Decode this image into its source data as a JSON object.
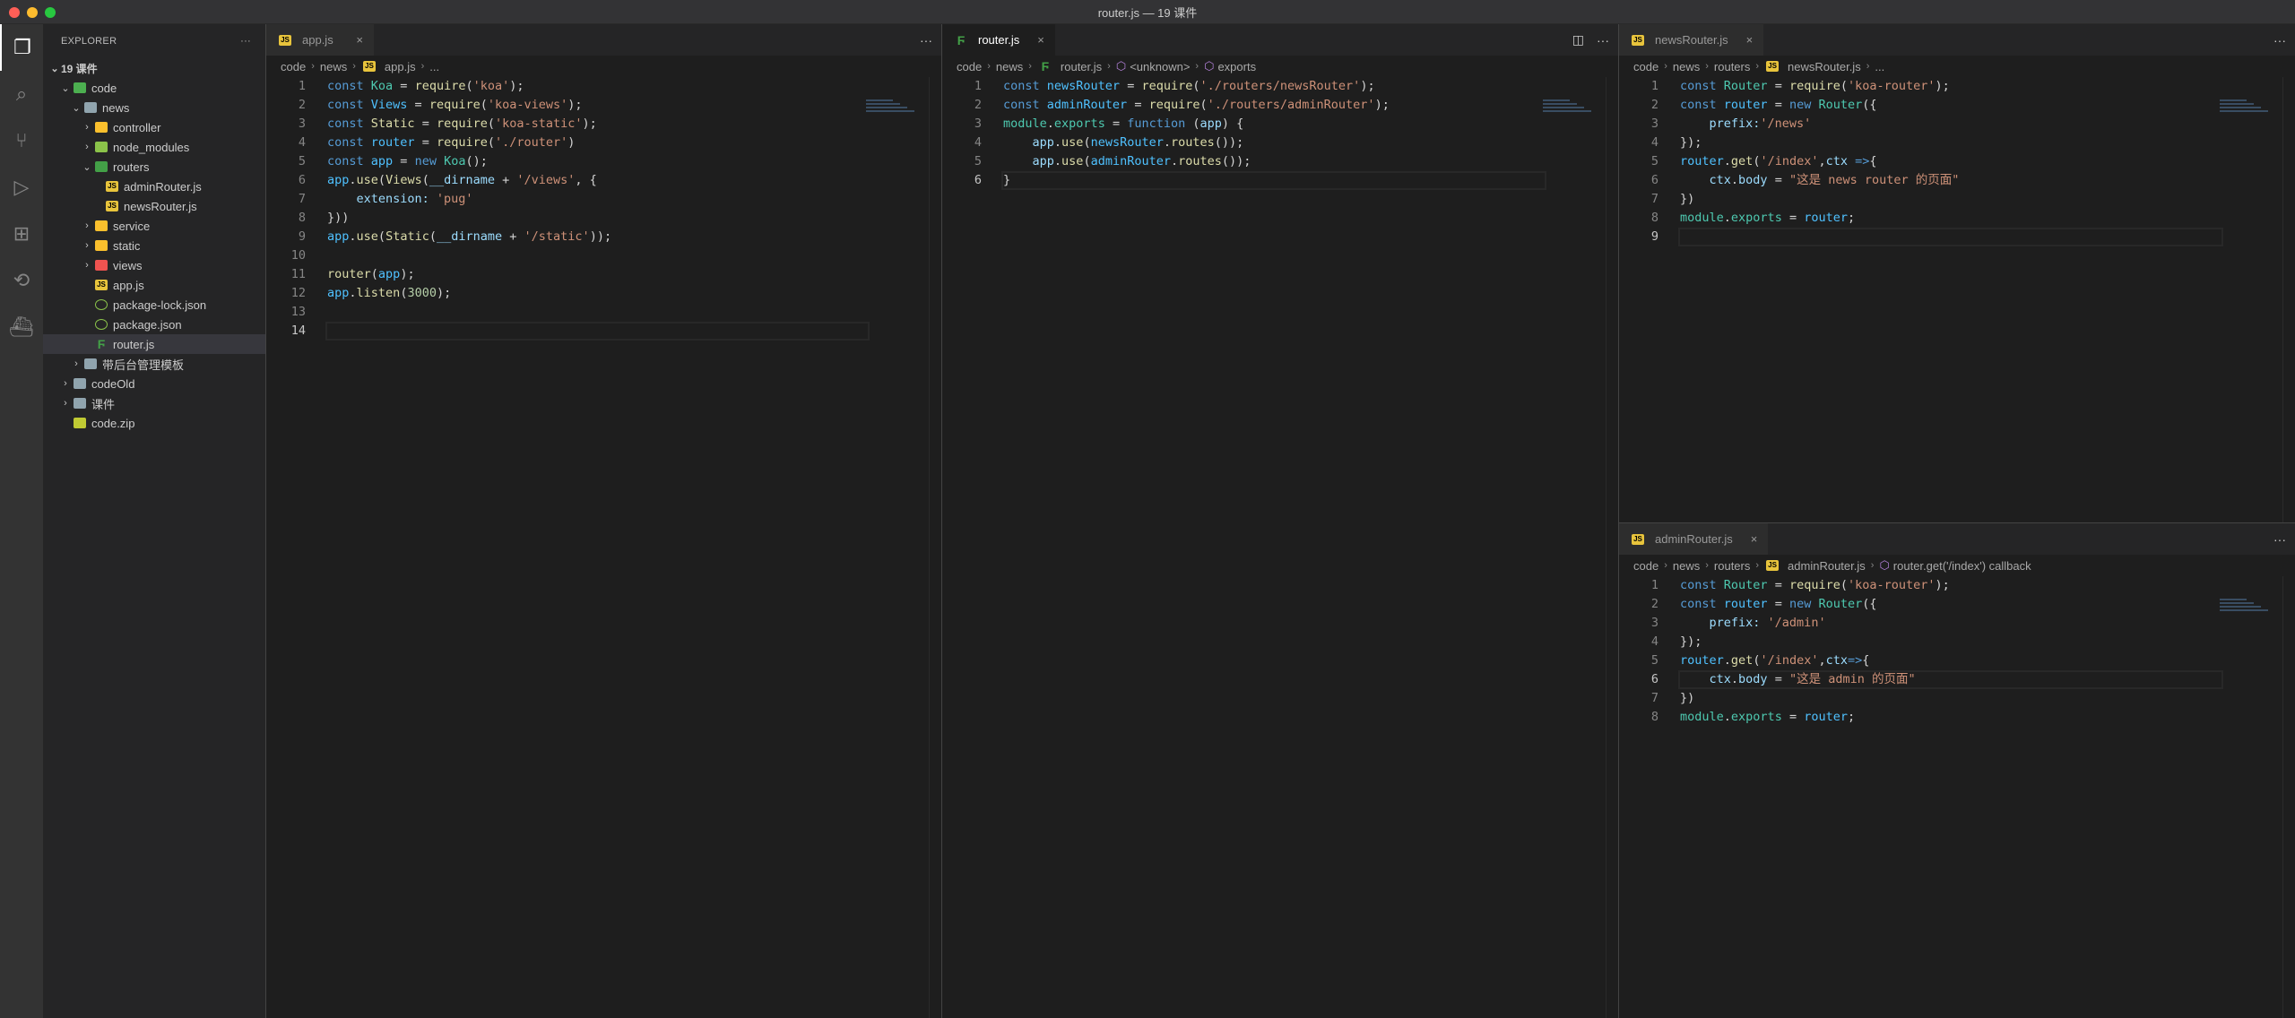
{
  "window": {
    "title": "router.js — 19 课件"
  },
  "activity_bar": [
    "files-icon",
    "search-icon",
    "source-control-icon",
    "run-debug-icon",
    "extensions-icon",
    "remote-icon",
    "docker-icon"
  ],
  "sidebar": {
    "title": "EXPLORER",
    "more": "···",
    "root": "19 课件",
    "items": [
      {
        "label": "code",
        "depth": 1,
        "chevron": "v",
        "icon": "folder-src",
        "color": "#4caf50"
      },
      {
        "label": "news",
        "depth": 2,
        "chevron": "v",
        "icon": "folder",
        "color": "#90a4ae"
      },
      {
        "label": "controller",
        "depth": 3,
        "chevron": ">",
        "icon": "folder-controller",
        "color": "#fbc02d"
      },
      {
        "label": "node_modules",
        "depth": 3,
        "chevron": ">",
        "icon": "folder-node",
        "color": "#8bc34a"
      },
      {
        "label": "routers",
        "depth": 3,
        "chevron": "v",
        "icon": "folder-routes",
        "color": "#43a047"
      },
      {
        "label": "adminRouter.js",
        "depth": 4,
        "chevron": "",
        "icon": "js",
        "color": "#e8c43c"
      },
      {
        "label": "newsRouter.js",
        "depth": 4,
        "chevron": "",
        "icon": "js",
        "color": "#e8c43c"
      },
      {
        "label": "service",
        "depth": 3,
        "chevron": ">",
        "icon": "folder-service",
        "color": "#fbc02d"
      },
      {
        "label": "static",
        "depth": 3,
        "chevron": ">",
        "icon": "folder-static",
        "color": "#fbc02d"
      },
      {
        "label": "views",
        "depth": 3,
        "chevron": ">",
        "icon": "folder-views",
        "color": "#ef5350"
      },
      {
        "label": "app.js",
        "depth": 3,
        "chevron": "",
        "icon": "js",
        "color": "#e8c43c"
      },
      {
        "label": "package-lock.json",
        "depth": 3,
        "chevron": "",
        "icon": "nodejs",
        "color": "#8bc34a"
      },
      {
        "label": "package.json",
        "depth": 3,
        "chevron": "",
        "icon": "nodejs",
        "color": "#8bc34a"
      },
      {
        "label": "router.js",
        "depth": 3,
        "chevron": "",
        "icon": "routing",
        "color": "#43a047",
        "selected": true
      },
      {
        "label": "带后台管理模板",
        "depth": 2,
        "chevron": ">",
        "icon": "folder",
        "color": "#90a4ae"
      },
      {
        "label": "codeOld",
        "depth": 1,
        "chevron": ">",
        "icon": "folder",
        "color": "#90a4ae"
      },
      {
        "label": "课件",
        "depth": 1,
        "chevron": ">",
        "icon": "folder",
        "color": "#90a4ae"
      },
      {
        "label": "code.zip",
        "depth": 1,
        "chevron": "",
        "icon": "zip",
        "color": "#c0ca33"
      }
    ]
  },
  "editors": [
    {
      "tab": "app.js",
      "active": false,
      "icon": "js",
      "crumbs": [
        "code",
        "news",
        "app.js",
        "..."
      ],
      "current_line": 14,
      "lines": [
        [
          [
            "const ",
            "k"
          ],
          [
            "Koa",
            "c"
          ],
          [
            " = ",
            "p"
          ],
          [
            "require",
            "f"
          ],
          [
            "(",
            "p"
          ],
          [
            "'koa'",
            "s"
          ],
          [
            ");",
            "p"
          ]
        ],
        [
          [
            "const ",
            "k"
          ],
          [
            "Views",
            "b"
          ],
          [
            " = ",
            "p"
          ],
          [
            "require",
            "f"
          ],
          [
            "(",
            "p"
          ],
          [
            "'koa-views'",
            "s"
          ],
          [
            ");",
            "p"
          ]
        ],
        [
          [
            "const ",
            "k"
          ],
          [
            "Static",
            "f"
          ],
          [
            " = ",
            "p"
          ],
          [
            "require",
            "f"
          ],
          [
            "(",
            "p"
          ],
          [
            "'koa-static'",
            "s"
          ],
          [
            ");",
            "p"
          ]
        ],
        [
          [
            "const ",
            "k"
          ],
          [
            "router",
            "b"
          ],
          [
            " = ",
            "p"
          ],
          [
            "require",
            "f"
          ],
          [
            "(",
            "p"
          ],
          [
            "'./router'",
            "s"
          ],
          [
            ")",
            "p"
          ]
        ],
        [
          [
            "const ",
            "k"
          ],
          [
            "app",
            "b"
          ],
          [
            " = ",
            "p"
          ],
          [
            "new ",
            "k"
          ],
          [
            "Koa",
            "c"
          ],
          [
            "();",
            "p"
          ]
        ],
        [
          [
            "app",
            "b"
          ],
          [
            ".",
            "p"
          ],
          [
            "use",
            "f"
          ],
          [
            "(",
            "p"
          ],
          [
            "Views",
            "f"
          ],
          [
            "(",
            "p"
          ],
          [
            "__dirname",
            "v"
          ],
          [
            " + ",
            "p"
          ],
          [
            "'/views'",
            "s"
          ],
          [
            ", {",
            "p"
          ]
        ],
        [
          [
            "    extension: ",
            "v"
          ],
          [
            "'pug'",
            "s"
          ]
        ],
        [
          [
            "}))",
            "p"
          ]
        ],
        [
          [
            "app",
            "b"
          ],
          [
            ".",
            "p"
          ],
          [
            "use",
            "f"
          ],
          [
            "(",
            "p"
          ],
          [
            "Static",
            "f"
          ],
          [
            "(",
            "p"
          ],
          [
            "__dirname",
            "v"
          ],
          [
            " + ",
            "p"
          ],
          [
            "'/static'",
            "s"
          ],
          [
            "));",
            "p"
          ]
        ],
        [],
        [
          [
            "router",
            "f"
          ],
          [
            "(",
            "p"
          ],
          [
            "app",
            "b"
          ],
          [
            ");",
            "p"
          ]
        ],
        [
          [
            "app",
            "b"
          ],
          [
            ".",
            "p"
          ],
          [
            "listen",
            "f"
          ],
          [
            "(",
            "p"
          ],
          [
            "3000",
            "n"
          ],
          [
            ");",
            "p"
          ]
        ],
        [],
        []
      ]
    },
    {
      "tab": "router.js",
      "active": true,
      "icon": "routing",
      "crumbs": [
        "code",
        "news",
        "router.js",
        "<unknown>",
        "exports"
      ],
      "current_line": 6,
      "lines": [
        [
          [
            "const ",
            "k"
          ],
          [
            "newsRouter",
            "b"
          ],
          [
            " = ",
            "p"
          ],
          [
            "require",
            "f"
          ],
          [
            "(",
            "p"
          ],
          [
            "'./routers/newsRouter'",
            "s"
          ],
          [
            ");",
            "p"
          ]
        ],
        [
          [
            "const ",
            "k"
          ],
          [
            "adminRouter",
            "b"
          ],
          [
            " = ",
            "p"
          ],
          [
            "require",
            "f"
          ],
          [
            "(",
            "p"
          ],
          [
            "'./routers/adminRouter'",
            "s"
          ],
          [
            ");",
            "p"
          ]
        ],
        [
          [
            "module",
            "c"
          ],
          [
            ".",
            "p"
          ],
          [
            "exports",
            "c"
          ],
          [
            " = ",
            "p"
          ],
          [
            "function ",
            "k"
          ],
          [
            "(",
            "p"
          ],
          [
            "app",
            "v"
          ],
          [
            ") {",
            "p"
          ]
        ],
        [
          [
            "    app",
            "v"
          ],
          [
            ".",
            "p"
          ],
          [
            "use",
            "f"
          ],
          [
            "(",
            "p"
          ],
          [
            "newsRouter",
            "b"
          ],
          [
            ".",
            "p"
          ],
          [
            "routes",
            "f"
          ],
          [
            "());",
            "p"
          ]
        ],
        [
          [
            "    app",
            "v"
          ],
          [
            ".",
            "p"
          ],
          [
            "use",
            "f"
          ],
          [
            "(",
            "p"
          ],
          [
            "adminRouter",
            "b"
          ],
          [
            ".",
            "p"
          ],
          [
            "routes",
            "f"
          ],
          [
            "());",
            "p"
          ]
        ],
        [
          [
            "}",
            "p"
          ]
        ]
      ]
    },
    {
      "tab": "newsRouter.js",
      "active": false,
      "icon": "js",
      "crumbs": [
        "code",
        "news",
        "routers",
        "newsRouter.js",
        "..."
      ],
      "current_line": 9,
      "lines": [
        [
          [
            "const ",
            "k"
          ],
          [
            "Router",
            "c"
          ],
          [
            " = ",
            "p"
          ],
          [
            "require",
            "f"
          ],
          [
            "(",
            "p"
          ],
          [
            "'koa-router'",
            "s"
          ],
          [
            ");",
            "p"
          ]
        ],
        [
          [
            "const ",
            "k"
          ],
          [
            "router",
            "b"
          ],
          [
            " = ",
            "p"
          ],
          [
            "new ",
            "k"
          ],
          [
            "Router",
            "c"
          ],
          [
            "({",
            "p"
          ]
        ],
        [
          [
            "    prefix:",
            "v"
          ],
          [
            "'/news'",
            "s"
          ]
        ],
        [
          [
            "});",
            "p"
          ]
        ],
        [
          [
            "router",
            "b"
          ],
          [
            ".",
            "p"
          ],
          [
            "get",
            "f"
          ],
          [
            "(",
            "p"
          ],
          [
            "'/index'",
            "s"
          ],
          [
            ",",
            "p"
          ],
          [
            "ctx",
            "v"
          ],
          [
            " =>",
            "k"
          ],
          [
            "{",
            "p"
          ]
        ],
        [
          [
            "    ctx",
            "v"
          ],
          [
            ".",
            "p"
          ],
          [
            "body",
            "v"
          ],
          [
            " = ",
            "p"
          ],
          [
            "\"这是 news router 的页面\"",
            "s"
          ]
        ],
        [
          [
            "})",
            "p"
          ]
        ],
        [
          [
            "module",
            "c"
          ],
          [
            ".",
            "p"
          ],
          [
            "exports",
            "c"
          ],
          [
            " = ",
            "p"
          ],
          [
            "router",
            "b"
          ],
          [
            ";",
            "p"
          ]
        ],
        []
      ]
    },
    {
      "tab": "adminRouter.js",
      "active": false,
      "icon": "js",
      "crumbs": [
        "code",
        "news",
        "routers",
        "adminRouter.js",
        "router.get('/index') callback"
      ],
      "current_line": 6,
      "lines": [
        [
          [
            "const ",
            "k"
          ],
          [
            "Router",
            "c"
          ],
          [
            " = ",
            "p"
          ],
          [
            "require",
            "f"
          ],
          [
            "(",
            "p"
          ],
          [
            "'koa-router'",
            "s"
          ],
          [
            ");",
            "p"
          ]
        ],
        [
          [
            "const ",
            "k"
          ],
          [
            "router",
            "b"
          ],
          [
            " = ",
            "p"
          ],
          [
            "new ",
            "k"
          ],
          [
            "Router",
            "c"
          ],
          [
            "({",
            "p"
          ]
        ],
        [
          [
            "    prefix: ",
            "v"
          ],
          [
            "'/admin'",
            "s"
          ]
        ],
        [
          [
            "});",
            "p"
          ]
        ],
        [
          [
            "router",
            "b"
          ],
          [
            ".",
            "p"
          ],
          [
            "get",
            "f"
          ],
          [
            "(",
            "p"
          ],
          [
            "'/index'",
            "s"
          ],
          [
            ",",
            "p"
          ],
          [
            "ctx",
            "v"
          ],
          [
            "=>",
            "k"
          ],
          [
            "{",
            "p"
          ]
        ],
        [
          [
            "    ctx",
            "v"
          ],
          [
            ".",
            "p"
          ],
          [
            "body",
            "v"
          ],
          [
            " = ",
            "p"
          ],
          [
            "\"这是 admin 的页面\"",
            "s"
          ]
        ],
        [
          [
            "})",
            "p"
          ]
        ],
        [
          [
            "module",
            "c"
          ],
          [
            ".",
            "p"
          ],
          [
            "exports",
            "c"
          ],
          [
            " = ",
            "p"
          ],
          [
            "router",
            "b"
          ],
          [
            ";",
            "p"
          ]
        ]
      ]
    }
  ],
  "tab_actions": {
    "split": "split-editor-icon",
    "more": "···",
    "close": "×"
  }
}
